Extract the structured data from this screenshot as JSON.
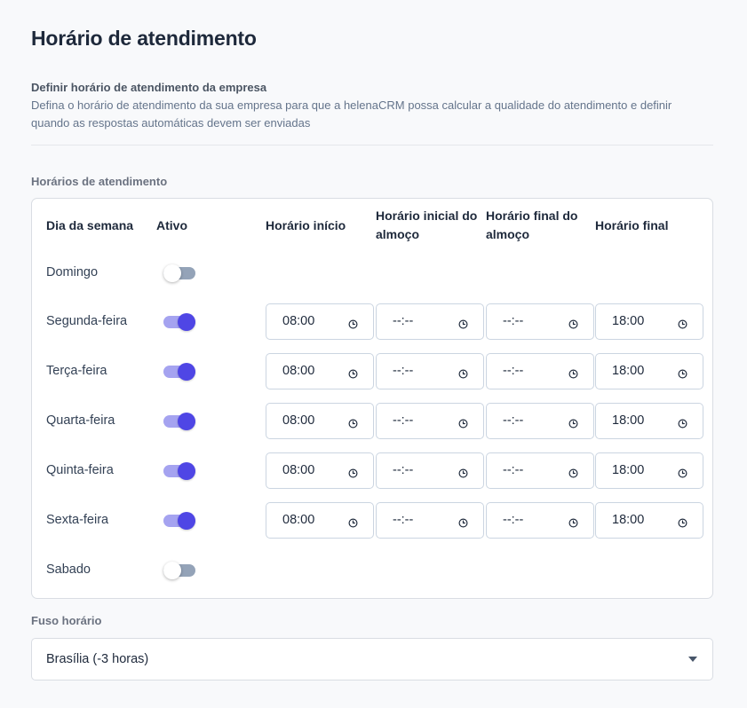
{
  "page": {
    "title": "Horário de atendimento",
    "subtitle": "Definir horário de atendimento da empresa",
    "description": "Defina o horário de atendimento da sua empresa para que a helenaCRM possa calcular a qualidade do atendimento e definir quando as respostas automáticas devem ser enviadas"
  },
  "schedule": {
    "label": "Horários de atendimento",
    "headers": {
      "day": "Dia da semana",
      "active": "Ativo",
      "start": "Horário início",
      "lunch_start": "Horário inicial do almoço",
      "lunch_end": "Horário final do almoço",
      "end": "Horário final"
    },
    "rows": [
      {
        "day": "Domingo",
        "active": false
      },
      {
        "day": "Segunda-feira",
        "active": true,
        "start": "08:00",
        "lunch_start": "--:--",
        "lunch_end": "--:--",
        "end": "18:00"
      },
      {
        "day": "Terça-feira",
        "active": true,
        "start": "08:00",
        "lunch_start": "--:--",
        "lunch_end": "--:--",
        "end": "18:00"
      },
      {
        "day": "Quarta-feira",
        "active": true,
        "start": "08:00",
        "lunch_start": "--:--",
        "lunch_end": "--:--",
        "end": "18:00"
      },
      {
        "day": "Quinta-feira",
        "active": true,
        "start": "08:00",
        "lunch_start": "--:--",
        "lunch_end": "--:--",
        "end": "18:00"
      },
      {
        "day": "Sexta-feira",
        "active": true,
        "start": "08:00",
        "lunch_start": "--:--",
        "lunch_end": "--:--",
        "end": "18:00"
      },
      {
        "day": "Sabado",
        "active": false
      }
    ]
  },
  "timezone": {
    "label": "Fuso horário",
    "value": "Brasília (-3 horas)"
  },
  "colors": {
    "accent": "#4f46e5",
    "accent_track": "#a5a3f0",
    "toggle_off": "#94a3b8"
  },
  "icons": {
    "time_field": "clock-icon",
    "select": "chevron-down-icon"
  }
}
